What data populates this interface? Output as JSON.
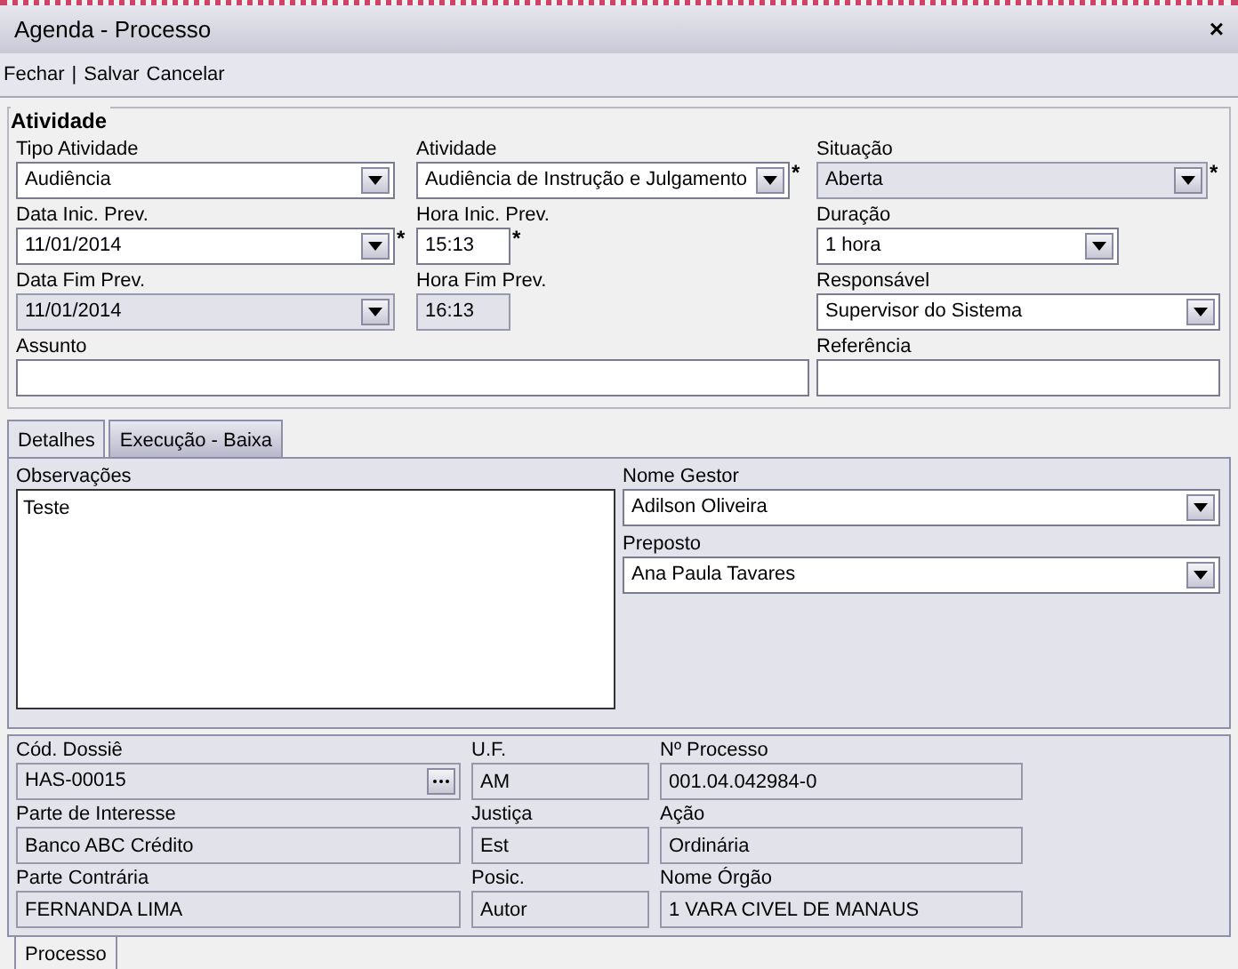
{
  "window": {
    "title": "Agenda - Processo",
    "close": "×"
  },
  "toolbar": [
    {
      "kind": "button",
      "label": "Fechar"
    },
    {
      "kind": "separator",
      "text": "|"
    },
    {
      "kind": "button",
      "label": "Salvar"
    },
    {
      "kind": "button",
      "label": "Cancelar"
    }
  ],
  "atividade": {
    "legend": "Atividade",
    "fields": [
      {
        "kind": "select",
        "label": "Tipo Atividade",
        "value": "Audiência",
        "disabled": false
      },
      {
        "kind": "select",
        "label": "Atividade",
        "value": "Audiência de Instrução e Julgamento",
        "disabled": false,
        "marker": "*"
      },
      {
        "kind": "select",
        "label": "Situação",
        "value": "Aberta",
        "disabled": true,
        "marker": "*"
      },
      {
        "kind": "select",
        "label": "Data Inic. Prev.",
        "value": "11/01/2014",
        "disabled": false,
        "marker": "*"
      },
      {
        "kind": "text",
        "label": "Hora Inic. Prev.",
        "value": "15:13",
        "disabled": false,
        "marker": "*"
      },
      {
        "kind": "select",
        "label": "Duração",
        "value": "1 hora",
        "disabled": false
      },
      {
        "kind": "select",
        "label": "Data Fim Prev.",
        "value": "11/01/2014",
        "disabled": true
      },
      {
        "kind": "text",
        "label": "Hora Fim Prev.",
        "value": "16:13",
        "disabled": true
      },
      {
        "kind": "select",
        "label": "Responsável",
        "value": "Supervisor do Sistema",
        "disabled": false
      },
      {
        "kind": "text",
        "label": "Assunto",
        "disabled": false
      },
      {
        "kind": "text",
        "label": "Referência",
        "disabled": false
      }
    ]
  },
  "tabs": [
    {
      "label": "Detalhes",
      "selected": true
    },
    {
      "label": "Execução - Baixa",
      "selected": false
    }
  ],
  "detalhes": {
    "observacoes": {
      "label": "Observações",
      "value": "Teste"
    },
    "fields": [
      {
        "kind": "select",
        "label": "Nome Gestor",
        "value": "Adilson Oliveira",
        "disabled": false
      },
      {
        "kind": "select",
        "label": "Preposto",
        "value": "Ana Paula Tavares",
        "disabled": false
      }
    ]
  },
  "processo": {
    "fields": [
      {
        "kind": "lookup",
        "label": "Cód. Dossiê",
        "value": "HAS-00015",
        "disabled": true
      },
      {
        "kind": "text",
        "label": "U.F.",
        "value": "AM",
        "disabled": true
      },
      {
        "kind": "text",
        "label": "Nº Processo",
        "value": "001.04.042984-0",
        "disabled": true
      },
      {
        "kind": "text",
        "label": "Parte de Interesse",
        "value": "Banco ABC Crédito",
        "disabled": true
      },
      {
        "kind": "text",
        "label": "Justiça",
        "value": "Est",
        "disabled": true
      },
      {
        "kind": "text",
        "label": "Ação",
        "value": "Ordinária",
        "disabled": true
      },
      {
        "kind": "text",
        "label": "Parte Contrária",
        "value": "FERNANDA LIMA",
        "disabled": true
      },
      {
        "kind": "text",
        "label": "Posic.",
        "value": "Autor",
        "disabled": true
      },
      {
        "kind": "text",
        "label": "Nome Órgão",
        "value": "1 VARA CIVEL DE MANAUS",
        "disabled": true
      }
    ]
  },
  "bottom_tabs": [
    {
      "label": "Processo",
      "selected": true
    }
  ]
}
